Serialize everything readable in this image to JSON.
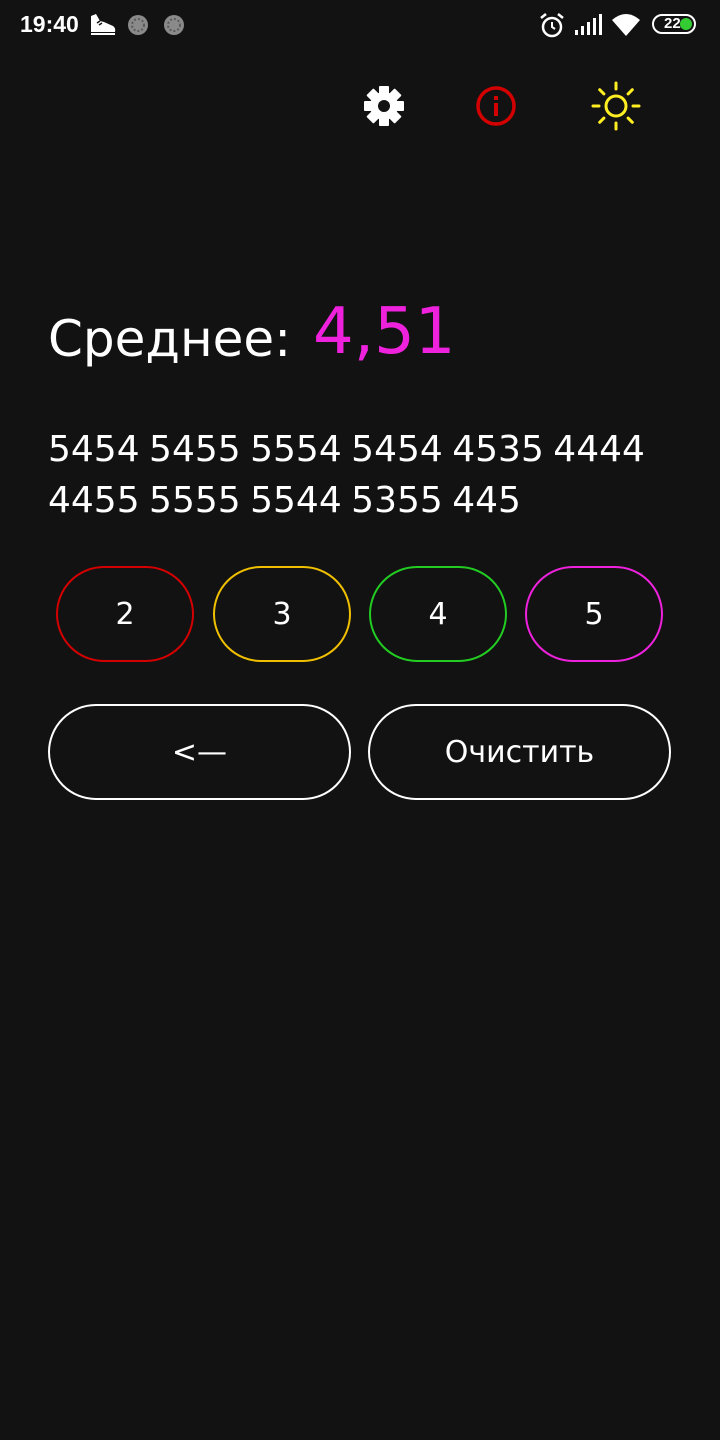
{
  "status_bar": {
    "time": "19:40",
    "battery": "22",
    "icons": [
      "shoe-icon",
      "notification-dot-icon",
      "notification-dot-icon",
      "alarm-icon",
      "signal-icon",
      "wifi-icon",
      "battery-icon"
    ]
  },
  "toolbar": {
    "icons": [
      "gear-icon",
      "info-icon",
      "sun-icon"
    ],
    "colors": {
      "settings": "#ffffff",
      "info": "#d40000",
      "theme": "#ffee22"
    }
  },
  "average": {
    "label": "Среднее:",
    "value": "4,51",
    "color": "#ee22dd"
  },
  "grades_text": "5454 5455 5554 5454 4535 4444 4455 5555 5544 5355 445",
  "grade_buttons": [
    {
      "label": "2",
      "color": "#d40000"
    },
    {
      "label": "3",
      "color": "#f0c000"
    },
    {
      "label": "4",
      "color": "#22cc22"
    },
    {
      "label": "5",
      "color": "#ee22dd"
    }
  ],
  "actions": {
    "back_label": "<—",
    "clear_label": "Очистить"
  }
}
